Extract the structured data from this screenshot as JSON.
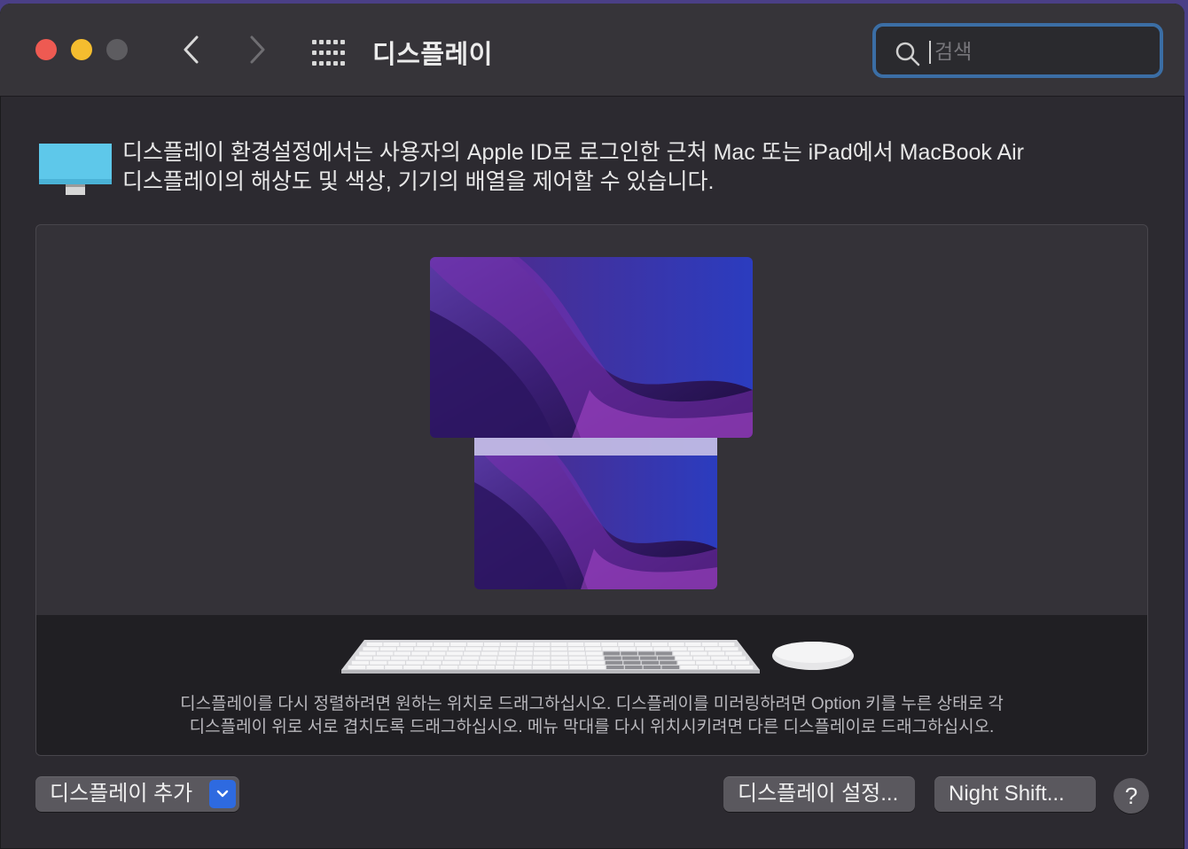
{
  "window": {
    "title": "디스플레이",
    "search": {
      "placeholder": "검색",
      "value": ""
    }
  },
  "info": {
    "line1": "디스플레이 환경설정에서는 사용자의 Apple ID로 로그인한 근처 Mac 또는 iPad에서 MacBook Air",
    "line2": "디스플레이의 해상도 및 색상, 기기의 배열을 제어할 수 있습니다."
  },
  "arrangement": {
    "help_line1": "디스플레이를 다시 정렬하려면 원하는 위치로 드래그하십시오. 디스플레이를 미러링하려면 Option 키를 누른 상태로 각",
    "help_line2": "디스플레이 위로 서로 겹치도록 드래그하십시오. 메뉴 막대를 다시 위치시키려면 다른 디스플레이로 드래그하십시오."
  },
  "buttons": {
    "add_display": "디스플레이 추가",
    "display_settings": "디스플레이 설정...",
    "night_shift": "Night Shift...",
    "help": "?"
  },
  "colors": {
    "accent": "#2e6ae0",
    "search_focus": "#3b6ea5",
    "close": "#ee5a52",
    "minimize": "#f5bd2f"
  },
  "icons": [
    "back-chevron-icon",
    "forward-chevron-icon",
    "show-all-grid-icon",
    "search-icon",
    "display-icon",
    "keyboard-icon",
    "mouse-icon",
    "chevron-down-icon"
  ]
}
